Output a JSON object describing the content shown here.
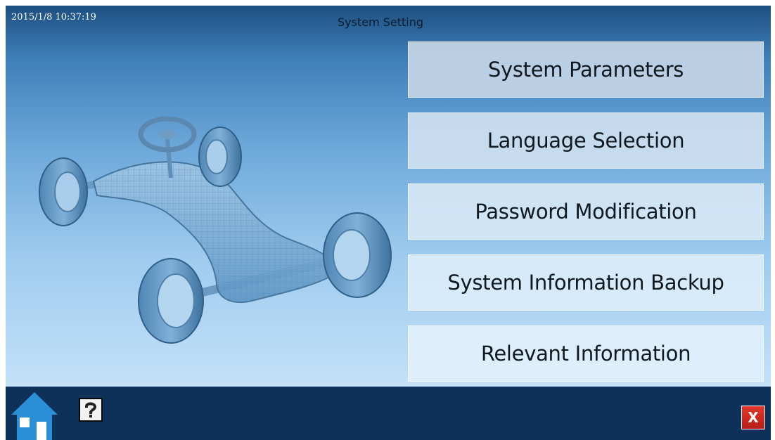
{
  "header": {
    "datetime": "2015/1/8 10:37:19",
    "title": "System Setting"
  },
  "menu": {
    "items": [
      {
        "label": "System Parameters"
      },
      {
        "label": "Language Selection"
      },
      {
        "label": "Password Modification"
      },
      {
        "label": "System Information Backup"
      },
      {
        "label": "Relevant Information"
      }
    ]
  },
  "bottom_bar": {
    "home_icon": "home-icon",
    "help_icon": "help-icon",
    "close_icon": "close-icon",
    "close_label": "X"
  },
  "colors": {
    "header_dark": "#1d4f80",
    "background_light": "#c4e1f7",
    "bottom_bar": "#0e3159",
    "close_red": "#d42a1e"
  }
}
